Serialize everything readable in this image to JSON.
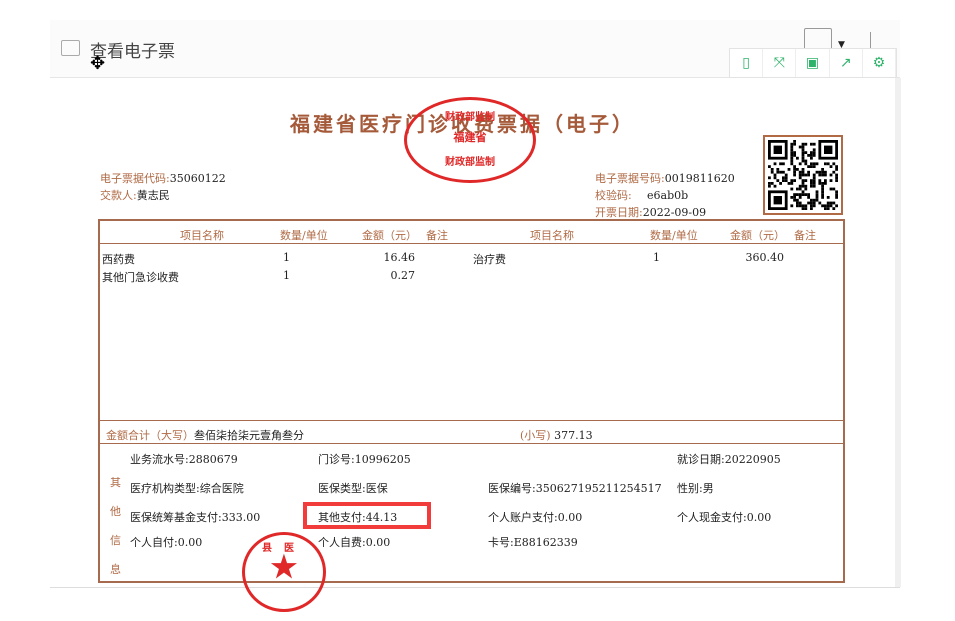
{
  "header": {
    "title": "查看电子票"
  },
  "toolbar": {
    "items": [
      "phone-icon",
      "fullscreen-icon",
      "save-icon",
      "share-icon",
      "settings-icon"
    ]
  },
  "invoice": {
    "title": "福建省医疗门诊收费票据（电子）",
    "stamp": {
      "top": "财政部监制",
      "middle": "福建省",
      "bottom": "财政部监制"
    },
    "left_info": [
      {
        "label": "电子票据代码:",
        "value": "35060122"
      },
      {
        "label": "交款人:",
        "value": "黄志民"
      }
    ],
    "right_info": [
      {
        "label": "电子票据号码:",
        "value": "0019811620"
      },
      {
        "label": "校验码:",
        "value": "e6ab0b"
      },
      {
        "label": "开票日期:",
        "value": "2022-09-09"
      }
    ],
    "columns": [
      "项目名称",
      "数量/单位",
      "金额（元）",
      "备注"
    ],
    "items_left": [
      {
        "name": "西药费",
        "qty": "1",
        "amount": "16.46"
      },
      {
        "name": "其他门急诊收费",
        "qty": "1",
        "amount": "0.27"
      }
    ],
    "items_right": [
      {
        "name": "治疗费",
        "qty": "1",
        "amount": "360.40"
      }
    ],
    "total": {
      "upper_label": "金额合计（大写）",
      "upper_value": "叁佰柒拾柒元壹角叁分",
      "lower_label": "(小写)",
      "lower_value": "377.13"
    },
    "other_label": "其他信息",
    "other": {
      "serial": "业务流水号:2880679",
      "outpatient": "门诊号:10996205",
      "visit_date": "就诊日期:20220905",
      "inst_type": "医疗机构类型:综合医院",
      "ins_type": "医保类型:医保",
      "ins_no": "医保编号:350627195211254517",
      "gender": "性别:男",
      "fund_pay": "医保统筹基金支付:333.00",
      "other_pay": "其他支付:44.13",
      "account_pay": "个人账户支付:0.00",
      "cash_pay": "个人现金支付:0.00",
      "self_pay": "个人自付:0.00",
      "self_expense": "个人自费:0.00",
      "card_no": "卡号:E88162339"
    },
    "hospital_stamp": "县医"
  },
  "colors": {
    "accent": "#2fb36b",
    "invoice_brown": "#a66a4f",
    "stamp_red": "#e02828",
    "highlight": "#f23b3b"
  }
}
